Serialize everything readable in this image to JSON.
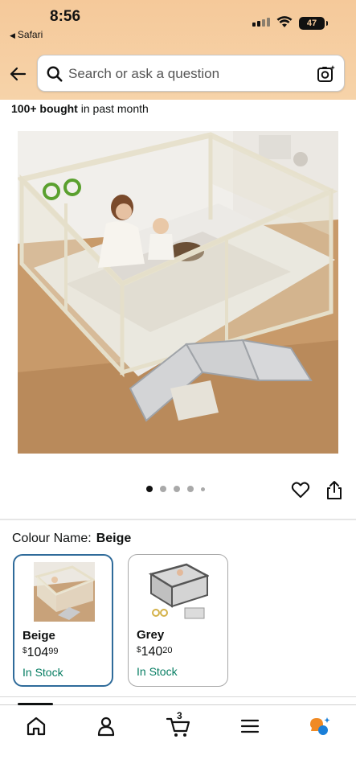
{
  "status_bar": {
    "time": "8:56",
    "back_app": "Safari",
    "battery": "47"
  },
  "search": {
    "placeholder": "Search or ask a question"
  },
  "social_proof": {
    "bold": "100+ bought",
    "rest": " in past month"
  },
  "gallery": {
    "total_images": 5,
    "active_index": 0
  },
  "variation": {
    "label": "Colour Name:",
    "selected": "Beige",
    "options": [
      {
        "name": "Beige",
        "currency": "$",
        "price_whole": "104",
        "price_fraction": "99",
        "stock": "In Stock",
        "selected": true
      },
      {
        "name": "Grey",
        "currency": "$",
        "price_whole": "140",
        "price_fraction": "20",
        "stock": "In Stock",
        "selected": false
      }
    ]
  },
  "bottom_nav": {
    "cart_count": "3",
    "items": [
      "home-icon",
      "account-icon",
      "cart-icon",
      "menu-icon",
      "rufus-icon"
    ]
  },
  "colors": {
    "header_bg": "#f5c99a",
    "selected_border": "#2f6b9a",
    "in_stock": "#067d62"
  }
}
